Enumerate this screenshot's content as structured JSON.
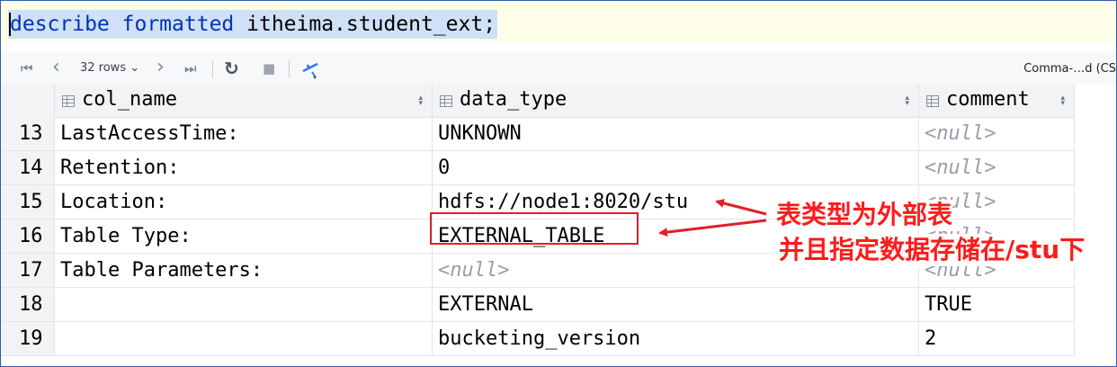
{
  "editor": {
    "keyword1": "describe",
    "keyword2": "formatted",
    "target": "itheima.student_ext;"
  },
  "toolbar": {
    "first_icon": "⏮",
    "prev_icon": "‹",
    "rows_label": "32 rows",
    "rows_caret": "⌄",
    "next_icon": "›",
    "last_icon": "⏭",
    "refresh_icon": "↻",
    "stop_icon": "■",
    "command_label": "Comma-…d (CS"
  },
  "grid": {
    "columns": [
      "col_name",
      "data_type",
      "comment"
    ],
    "rows": [
      {
        "n": "13",
        "col_name": "LastAccessTime:",
        "data_type": "UNKNOWN",
        "comment": "<null>",
        "comment_null": true
      },
      {
        "n": "14",
        "col_name": "Retention:",
        "data_type": "0",
        "comment": "<null>",
        "comment_null": true
      },
      {
        "n": "15",
        "col_name": "Location:",
        "data_type": "hdfs://node1:8020/stu",
        "comment": "<null>",
        "comment_null": true
      },
      {
        "n": "16",
        "col_name": "Table Type:",
        "data_type": "EXTERNAL_TABLE",
        "comment": "<null>",
        "comment_null": true
      },
      {
        "n": "17",
        "col_name": "Table Parameters:",
        "data_type": "<null>",
        "data_null": true,
        "comment": "<null>",
        "comment_null": true
      },
      {
        "n": "18",
        "col_name": "",
        "data_type": "EXTERNAL",
        "comment": "TRUE"
      },
      {
        "n": "19",
        "col_name": "",
        "data_type": "bucketing_version",
        "comment": "2"
      }
    ]
  },
  "annotation": {
    "line1": "表类型为外部表",
    "line2": "并且指定数据存储在/stu下",
    "color": "#ff1a1a"
  }
}
